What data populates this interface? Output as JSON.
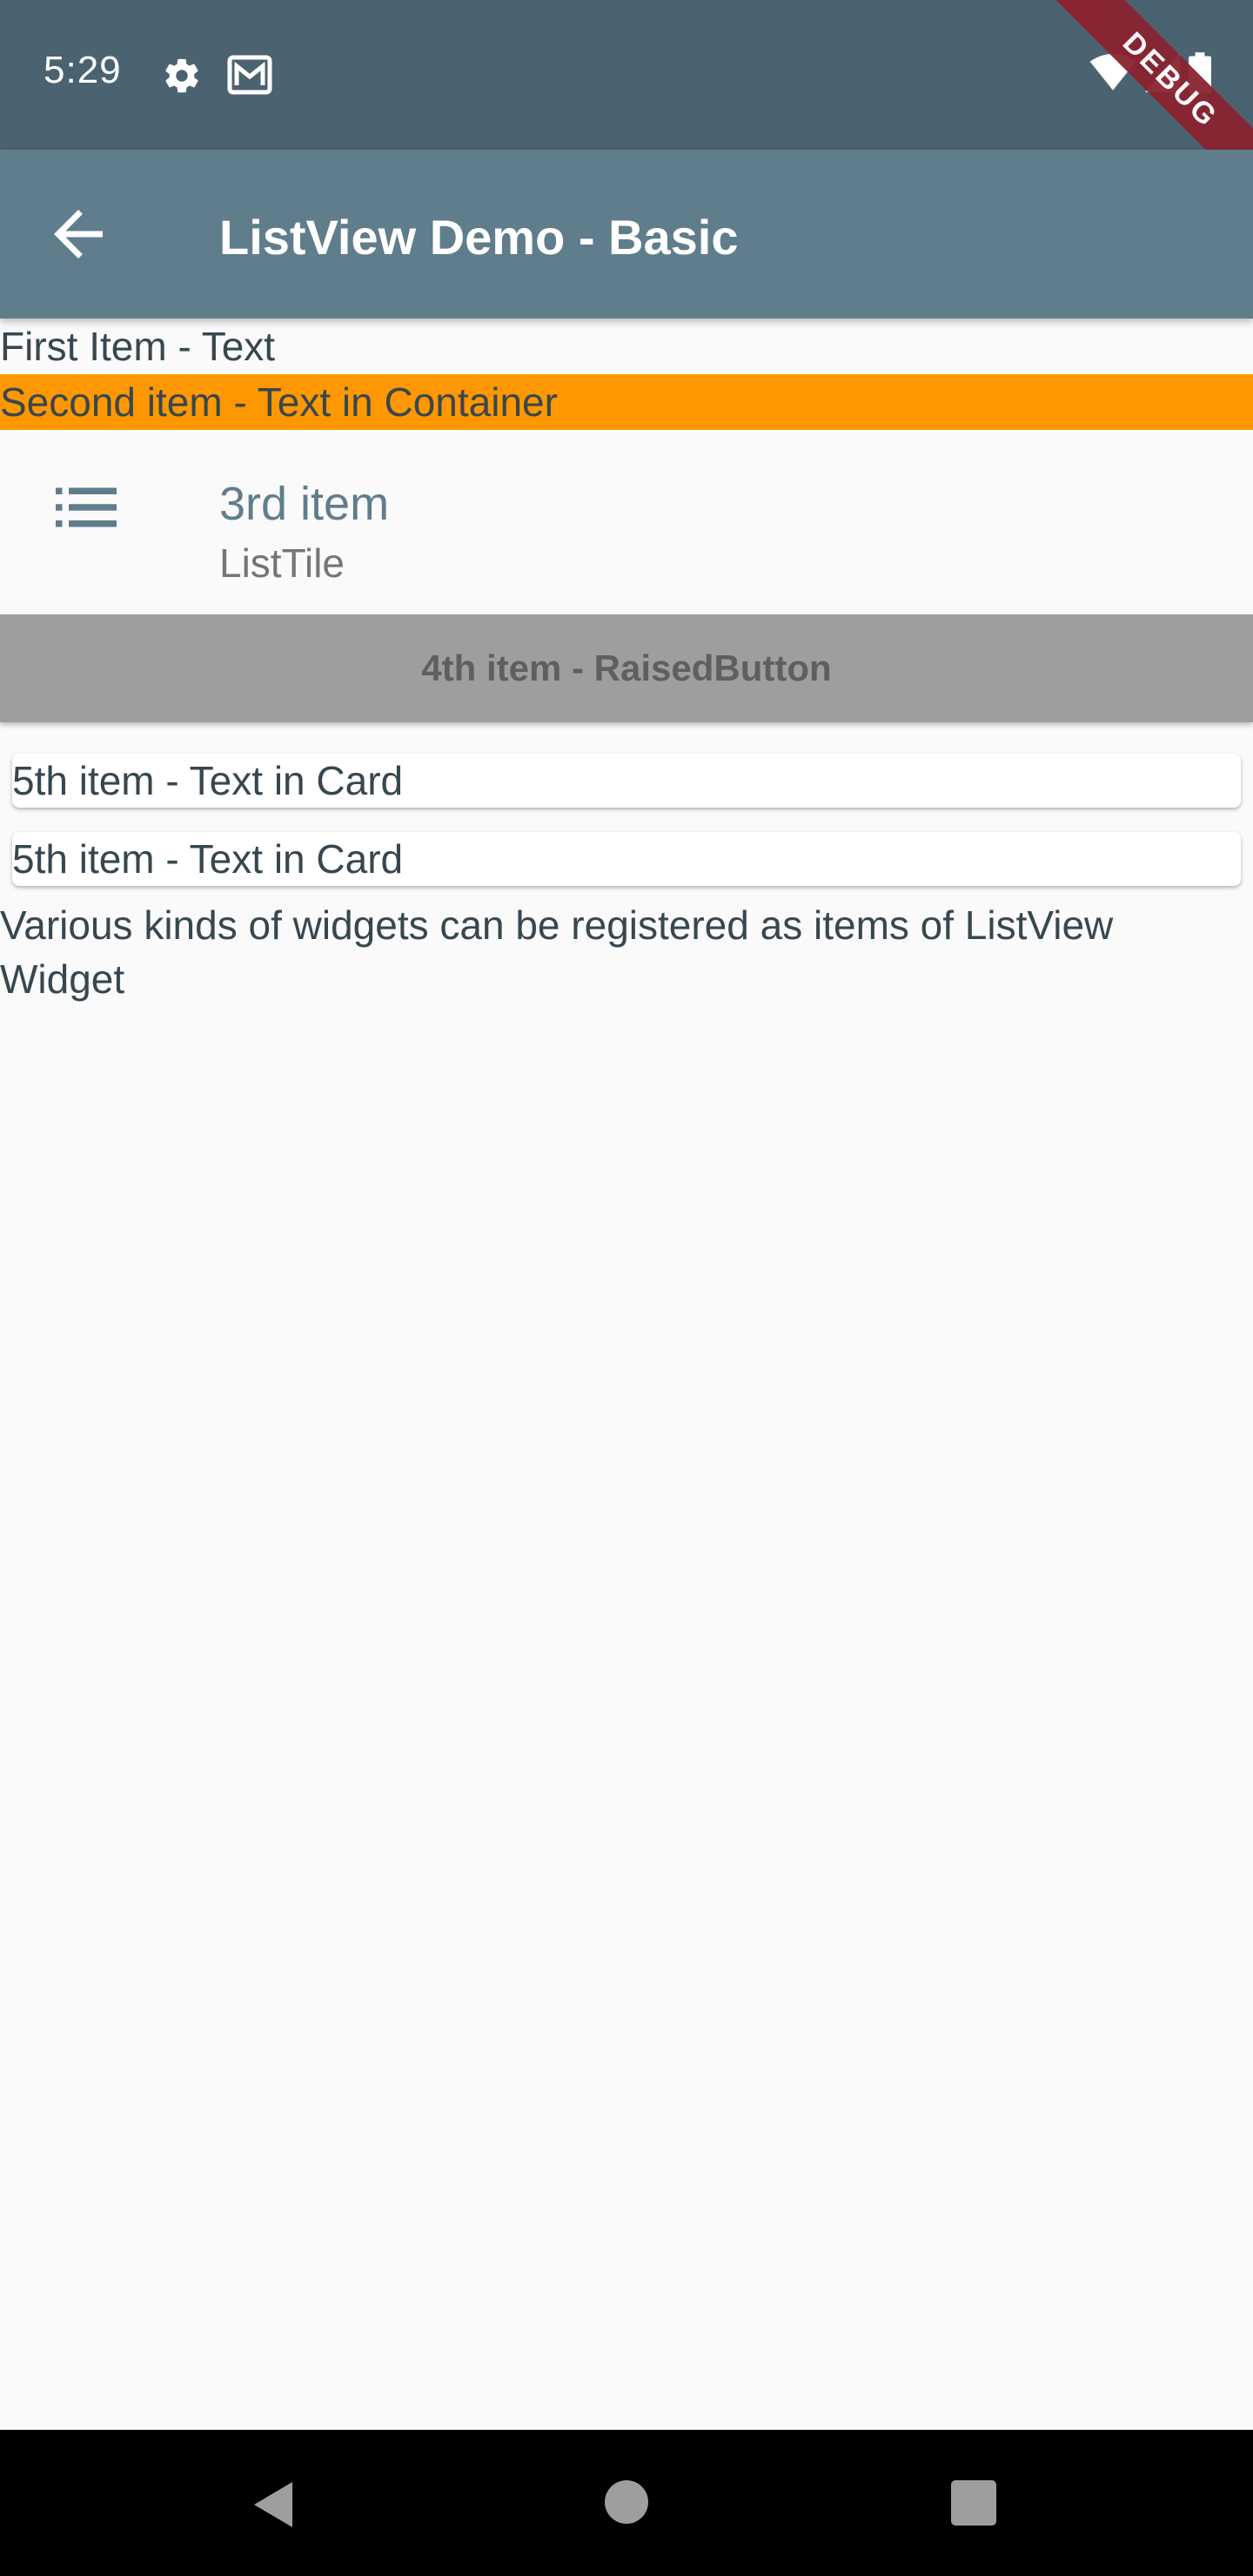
{
  "status_bar": {
    "time": "5:29",
    "icons": [
      "settings-icon",
      "mail-icon",
      "wifi-icon",
      "signal-icon",
      "battery-icon"
    ],
    "debug_label": "DEBUG"
  },
  "app_bar": {
    "title": "ListView Demo - Basic",
    "back_icon": "arrow-back-icon",
    "background_color": "#607d8b"
  },
  "list": {
    "first_item": "First Item - Text",
    "second_item": "Second item - Text in Container",
    "second_item_color": "#ff9800",
    "third_item": {
      "icon": "list-icon",
      "title": "3rd item",
      "subtitle": "ListTile"
    },
    "fourth_item": "4th item - RaisedButton",
    "fifth_item_a": "5th item - Text in Card",
    "fifth_item_b": "5th item - Text in Card",
    "description": "Various kinds of widgets can be registered as items of ListView Widget"
  },
  "nav_bar": {
    "icons": [
      "back-triangle-icon",
      "home-circle-icon",
      "recents-square-icon"
    ]
  }
}
